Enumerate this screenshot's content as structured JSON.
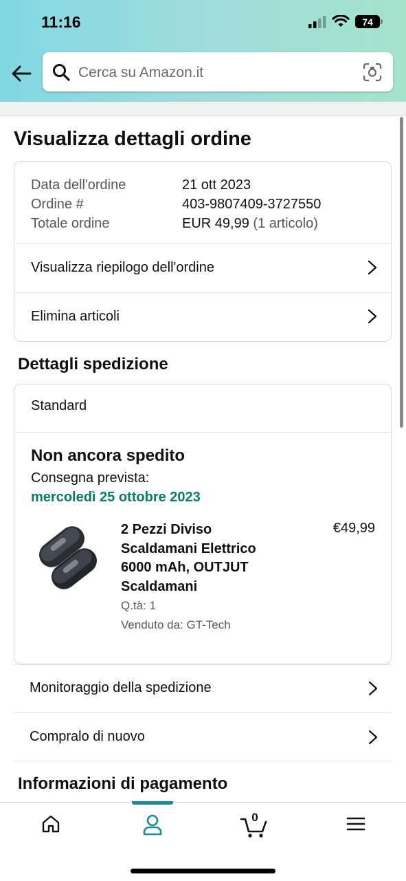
{
  "status_bar": {
    "time": "11:16",
    "battery": "74"
  },
  "search": {
    "placeholder": "Cerca su Amazon.it"
  },
  "page": {
    "title": "Visualizza dettagli ordine"
  },
  "order": {
    "date_label": "Data dell'ordine",
    "date_value": "21 ott 2023",
    "number_label": "Ordine #",
    "number_value": "403-9807409-3727550",
    "total_label": "Totale ordine",
    "total_value": "EUR 49,99",
    "total_items": "(1 articolo)",
    "summary_link": "Visualizza riepilogo dell'ordine",
    "delete_link": "Elimina articoli"
  },
  "shipment": {
    "section_title": "Dettagli spedizione",
    "type": "Standard",
    "status": "Non ancora spedito",
    "delivery_label": "Consegna prevista:",
    "delivery_date": "mercoledì 25 ottobre 2023",
    "product": {
      "name": "2 Pezzi Diviso Scaldamani Elettrico 6000 mAh, OUTJUT Scaldamani",
      "price": "€49,99",
      "quantity": "Q.tà: 1",
      "seller": "Venduto da: GT-Tech"
    },
    "track_link": "Monitoraggio della spedizione",
    "buy_again_link": "Compralo di nuovo"
  },
  "payment": {
    "section_title": "Informazioni di pagamento"
  },
  "bottom_nav": {
    "cart_count": "0"
  },
  "colors": {
    "accent": "#1b8a9d",
    "delivery_green": "#067d62"
  }
}
